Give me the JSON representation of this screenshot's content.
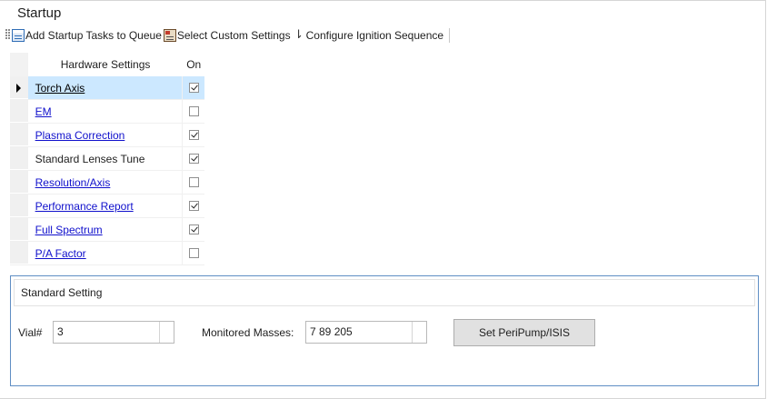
{
  "title": "Startup",
  "toolbar": {
    "add_tasks_label": "Add Startup Tasks to Queue",
    "select_custom_label": "Select Custom Settings",
    "configure_ignition_label": "Configure Ignition Sequence"
  },
  "grid": {
    "header_name": "Hardware Settings",
    "header_on": "On",
    "rows": [
      {
        "name": "Torch Axis",
        "on": true,
        "link": true,
        "selected": true
      },
      {
        "name": "EM",
        "on": false,
        "link": true,
        "selected": false
      },
      {
        "name": "Plasma Correction",
        "on": true,
        "link": true,
        "selected": false
      },
      {
        "name": "Standard Lenses Tune",
        "on": true,
        "link": false,
        "selected": false
      },
      {
        "name": "Resolution/Axis",
        "on": false,
        "link": true,
        "selected": false
      },
      {
        "name": "Performance Report",
        "on": true,
        "link": true,
        "selected": false
      },
      {
        "name": "Full Spectrum",
        "on": true,
        "link": true,
        "selected": false
      },
      {
        "name": "P/A Factor",
        "on": false,
        "link": true,
        "selected": false
      }
    ]
  },
  "group": {
    "header": "Standard Setting",
    "vial_label": "Vial#",
    "vial_value": "3",
    "masses_label": "Monitored Masses:",
    "masses_value": "7 89 205",
    "set_button_label": "Set PeriPump/ISIS"
  },
  "colors": {
    "link": "#1010cc",
    "selection": "#cce8ff",
    "group_border": "#5f8ec4"
  }
}
